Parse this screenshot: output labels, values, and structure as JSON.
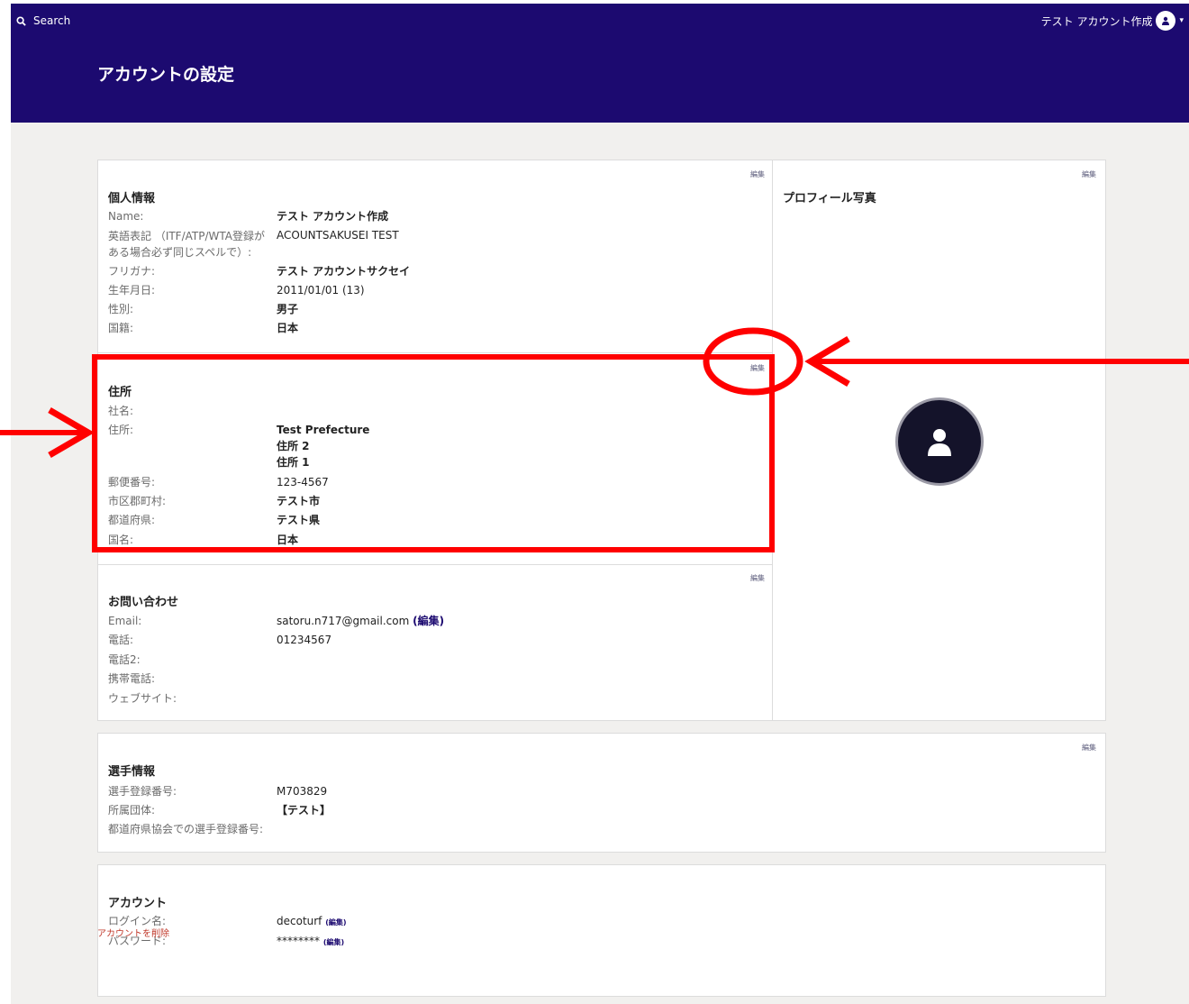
{
  "topbar": {
    "search_label": "Search",
    "user_name": "テスト アカウント作成",
    "page_title": "アカウントの設定"
  },
  "edit_label": "編集",
  "personal": {
    "title": "個人情報",
    "rows": [
      {
        "label": "Name:",
        "value": "テスト アカウント作成"
      },
      {
        "label": "英語表記 （ITF/ATP/WTA登録がある場合必ず同じスペルで）:",
        "value": "ACOUNTSAKUSEI TEST"
      },
      {
        "label": "フリガナ:",
        "value": "テスト アカウントサクセイ"
      },
      {
        "label": "生年月日:",
        "value": "2011/01/01 (13)"
      },
      {
        "label": "性別:",
        "value": "男子"
      },
      {
        "label": "国籍:",
        "value": "日本"
      }
    ]
  },
  "profile_photo": {
    "title": "プロフィール写真"
  },
  "address": {
    "title": "住所",
    "rows": [
      {
        "label": "社名:",
        "value": ""
      },
      {
        "label": "住所:",
        "value_lines": [
          "Test Prefecture",
          "住所 2",
          "住所 1"
        ]
      },
      {
        "label": "郵便番号:",
        "value": "123-4567"
      },
      {
        "label": "市区郡町村:",
        "value": "テスト市"
      },
      {
        "label": "都道府県:",
        "value": "テスト県"
      },
      {
        "label": "国名:",
        "value": "日本"
      }
    ]
  },
  "contact": {
    "title": "お問い合わせ",
    "rows": [
      {
        "label": "Email:",
        "value": "satoru.n717@gmail.com",
        "edit": "(編集)"
      },
      {
        "label": "電話:",
        "value": "01234567"
      },
      {
        "label": "電話2:",
        "value": ""
      },
      {
        "label": "携帯電話:",
        "value": ""
      },
      {
        "label": "ウェブサイト:",
        "value": ""
      }
    ]
  },
  "player": {
    "title": "選手情報",
    "rows": [
      {
        "label": "選手登録番号:",
        "value": "M703829"
      },
      {
        "label": "所属団体:",
        "value": "【テスト】"
      },
      {
        "label": "都道府県協会での選手登録番号:",
        "value": ""
      }
    ]
  },
  "account": {
    "title": "アカウント",
    "rows": [
      {
        "label": "ログイン名:",
        "value": "decoturf",
        "edit": "(編集)"
      },
      {
        "label": "パスワード:",
        "value": "********",
        "edit": "(編集)"
      }
    ]
  },
  "delete_account": "アカウントを削除",
  "colors": {
    "header_bg": "#1c0a70",
    "page_bg": "#f1f0ee",
    "annotation_red": "#ff0000",
    "delete_red": "#c0392b"
  }
}
